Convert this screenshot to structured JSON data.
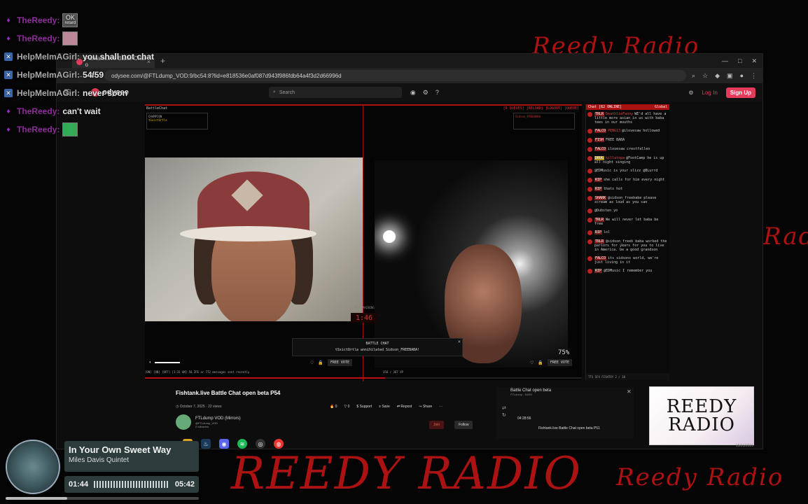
{
  "stream_chat": [
    {
      "user": "TheReedy:",
      "badge": "mic",
      "msg": "",
      "emote": "OK"
    },
    {
      "user": "TheReedy:",
      "badge": "mic",
      "msg": "",
      "emote": "pink"
    },
    {
      "user": "HelpMeImAGirl:",
      "badge": "x",
      "msg": "you shall not chat",
      "emote": ""
    },
    {
      "user": "HelpMeImAGirl:",
      "badge": "x",
      "msg": "54/59",
      "emote": ""
    },
    {
      "user": "HelpMeImAGirl:",
      "badge": "x",
      "msg": "never soon",
      "emote": ""
    },
    {
      "user": "TheReedy:",
      "badge": "mic",
      "msg": "can't wait",
      "emote": ""
    },
    {
      "user": "TheReedy:",
      "badge": "mic",
      "msg": "",
      "emote": "green"
    }
  ],
  "emote_ok": "OK",
  "emote_ok_sub": "retard",
  "browser": {
    "tab_title": "Fishtank.live Battle Chat o",
    "url": "odysee.com/@FTLdump_VOD:9/bc54:8?lid=e818536e0af087d943f986fdb64a4f3d2d66996d",
    "site_name": "odysee",
    "search_placeholder": "Search",
    "login": "Log In",
    "signup": "Sign Up"
  },
  "battle": {
    "title": "BattleChat",
    "tags": "[9 QUEUES] [RELOAD] [LOGOUT] [QUEUE]",
    "champion_label": "CHAMPION",
    "champion_name": "tSxictOrtla",
    "challenger_name": "Sidson_FREEBABA",
    "timer_label": "1.96 REMAINING",
    "timer": "1:46",
    "msg_title": "BATTLE CHAT",
    "msg_body": "tSxictOrtla annihilated Sidson_FREEBABA!",
    "percent": "75%",
    "free_vote": "FREE VOTE",
    "status": "[ON] [ON] [OFF] [1:31 AM]        56 ZFE or 772 messages sent recently",
    "score": "356 / 367 XP"
  },
  "chat": {
    "header": "Chat [82 ONLINE]",
    "header_right": "Global",
    "messages": [
      {
        "tag": "TRLR",
        "name": "DeathlieFanny",
        "text": "WE'd all have a little more asian in us with baba tees in our mouths"
      },
      {
        "tag": "FALCO",
        "name": "PENG13",
        "text": "@ilovesaw hollowed"
      },
      {
        "tag": "FISH",
        "name": "",
        "text": "FREE BABA"
      },
      {
        "tag": "FALCO",
        "name": "",
        "text": "ilovesaw crestfallen"
      },
      {
        "tag": "DRUG",
        "name": "killatopa",
        "text": "@FootCamp he is up all night singing"
      },
      {
        "tag": "",
        "name": "",
        "text": "@EDMusic is your slizz @BLurrd"
      },
      {
        "tag": "RIP",
        "name": "",
        "text": "she calls for him every night"
      },
      {
        "tag": "RIP",
        "name": "",
        "text": "thats hot"
      },
      {
        "tag": "SHARK",
        "name": "",
        "text": "@sidson_freebabe please scream as loud as you can"
      },
      {
        "tag": "",
        "name": "",
        "text": "@Dubsten yo"
      },
      {
        "tag": "TRLR",
        "name": "",
        "text": "We will never let baba be free"
      },
      {
        "tag": "RIP",
        "name": "",
        "text": "lol"
      },
      {
        "tag": "TRLR",
        "name": "",
        "text": "@sidson_freeb baba worked the parlors for years for you to live in America. be a good grandson"
      },
      {
        "tag": "FALCO",
        "name": "",
        "text": "its sidsons world, we're just living in it"
      },
      {
        "tag": "RIP",
        "name": "",
        "text": "@EDMusic I remember you"
      }
    ],
    "footer": "TTS  SFX  FISHTOY 2 / 30"
  },
  "video": {
    "title": "Fishtank.live Battle Chat open beta P54",
    "date": "October 7, 2025",
    "views": "22 views",
    "likes": "0",
    "dislikes": "0",
    "support": "Support",
    "save": "Save",
    "repost": "Repost",
    "share": "Share",
    "channel": "FTLdump VOD (Mirrors)",
    "channel_handle": "@FTLdump_VOD",
    "followers": "2 followers",
    "join": "Join",
    "follow": "Follow"
  },
  "miniplayer": {
    "title": "Battle Chat open beta",
    "sub": "FTLdump - 54/59",
    "time": "04:28:56",
    "next": "Fishtank.live Battle Chat open beta P51"
  },
  "reedy_logo_line1": "REEDY",
  "reedy_logo_line2": "RADIO",
  "reedy_date": "15/01/2026",
  "scrawls": {
    "reedy_radio": "REEDY RADIO",
    "reedy_radio_small": "Reedy Radio",
    "radio": "Radio"
  },
  "music": {
    "title": "In Your Own Sweet Way",
    "artist": "Miles Davis Quintet",
    "elapsed": "01:44",
    "duration": "05:42",
    "progress": 0.32
  }
}
